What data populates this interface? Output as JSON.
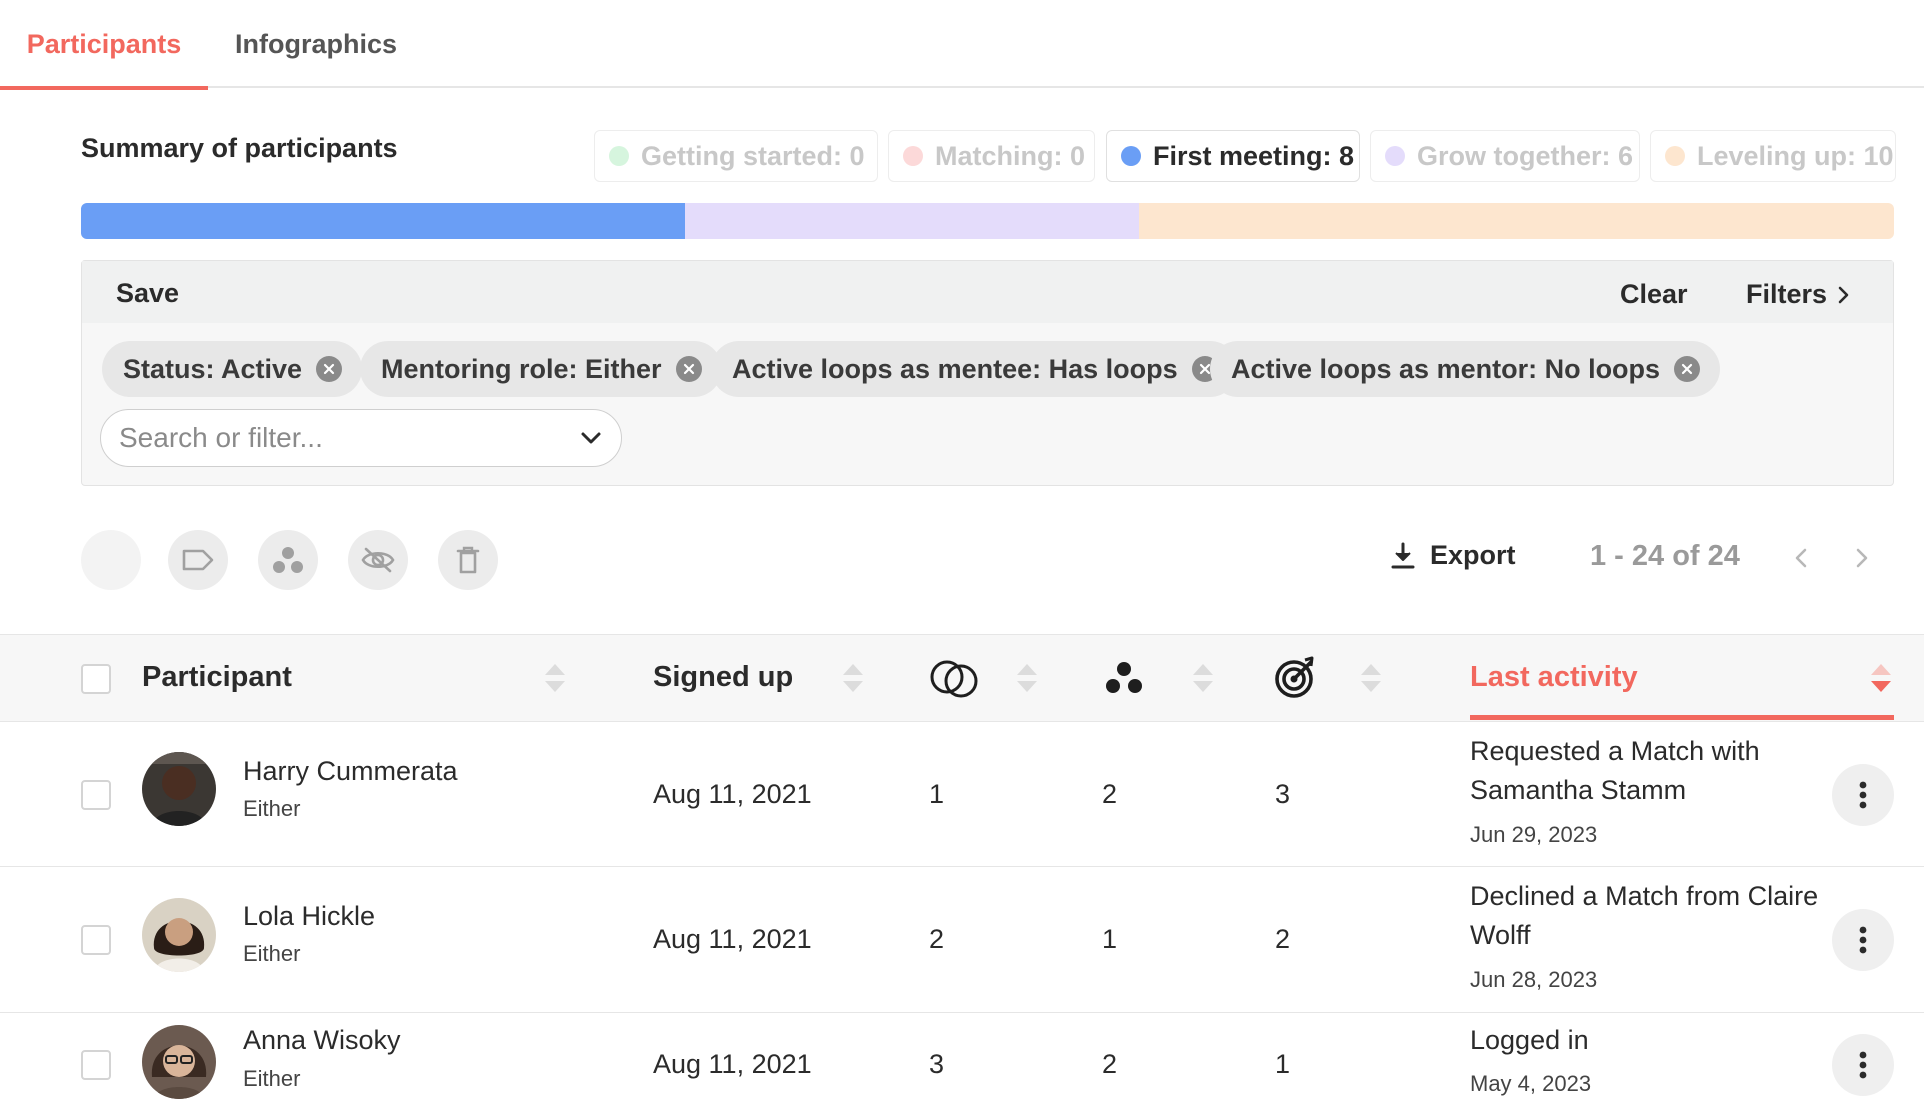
{
  "tabs": [
    {
      "label": "Participants",
      "active": true
    },
    {
      "label": "Infographics",
      "active": false
    }
  ],
  "summary": {
    "title": "Summary of participants",
    "stages": [
      {
        "label": "Getting started: 0",
        "count": 0,
        "color": "#d6f5de",
        "active": false
      },
      {
        "label": "Matching: 0",
        "count": 0,
        "color": "#fcd9d9",
        "active": false
      },
      {
        "label": "First meeting: 8",
        "count": 8,
        "color": "#6a9ef5",
        "active": true
      },
      {
        "label": "Grow together: 6",
        "count": 6,
        "color": "#e4dcfb",
        "active": false
      },
      {
        "label": "Leveling up: 10",
        "count": 10,
        "color": "#fde6cf",
        "active": false
      }
    ]
  },
  "filters": {
    "save_label": "Save",
    "clear_label": "Clear",
    "filters_label": "Filters",
    "chips": [
      {
        "label": "Status: Active"
      },
      {
        "label": "Mentoring role: Either"
      },
      {
        "label": "Active loops as mentee: Has loops"
      },
      {
        "label": "Active loops as mentor: No loops"
      }
    ],
    "search_placeholder": "Search or filter..."
  },
  "toolbar": {
    "icons": [
      "blank-icon",
      "tag-icon",
      "group-icon",
      "hide-icon",
      "trash-icon"
    ],
    "export_label": "Export",
    "pagination": "1 - 24 of 24"
  },
  "table": {
    "headers": {
      "participant": "Participant",
      "signed_up": "Signed up",
      "loops_icon": "loops-icon",
      "group_icon": "group-icon",
      "goals_icon": "target-icon",
      "last_activity": "Last activity"
    },
    "sorted_column": "last_activity",
    "sort_direction": "descending",
    "rows": [
      {
        "name": "Harry Cummerata",
        "role": "Either",
        "signed_up": "Aug 11, 2021",
        "loops": "1",
        "group": "2",
        "goals": "3",
        "activity": "Requested a Match with Samantha Stamm",
        "activity_date": "Jun 29, 2023"
      },
      {
        "name": "Lola Hickle",
        "role": "Either",
        "signed_up": "Aug 11, 2021",
        "loops": "2",
        "group": "1",
        "goals": "2",
        "activity": "Declined a Match from Claire Wolff",
        "activity_date": "Jun 28, 2023"
      },
      {
        "name": "Anna Wisoky",
        "role": "Either",
        "signed_up": "Aug 11, 2021",
        "loops": "3",
        "group": "2",
        "goals": "1",
        "activity": "Logged in",
        "activity_date": "May 4, 2023"
      }
    ]
  },
  "colors": {
    "accent": "#f2685e",
    "progress_first_meeting": "#6a9ef5",
    "progress_grow_together": "#e4dcfb",
    "progress_leveling_up": "#fde6cf"
  }
}
